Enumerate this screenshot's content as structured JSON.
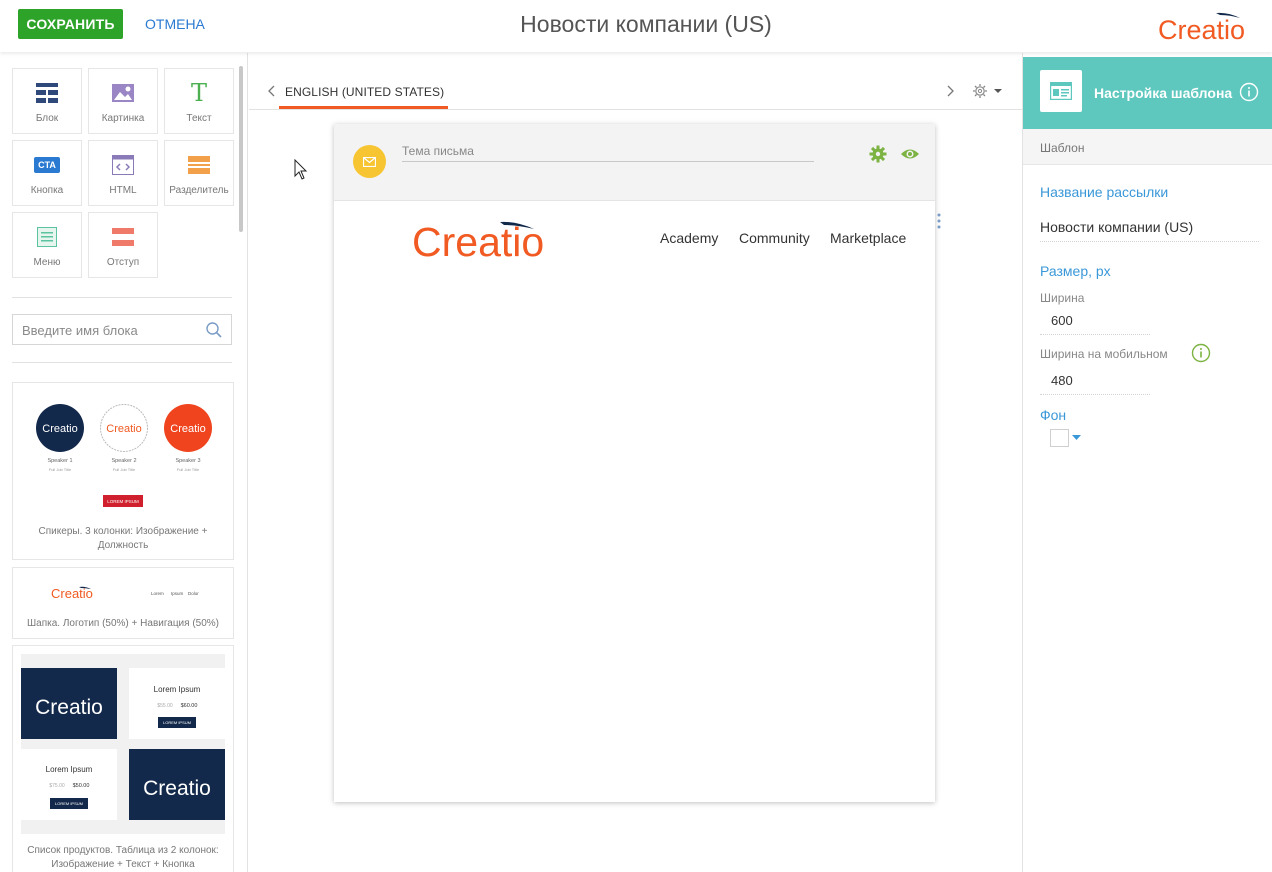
{
  "topbar": {
    "save_label": "СОХРАНИТЬ",
    "cancel_label": "ОТМЕНА",
    "title": "Новости компании (US)",
    "brand": "Creatio"
  },
  "palette": {
    "items": [
      {
        "label": "Блок",
        "icon": "block-grid-icon"
      },
      {
        "label": "Картинка",
        "icon": "image-icon"
      },
      {
        "label": "Текст",
        "icon": "text-t-icon"
      },
      {
        "label": "Кнопка",
        "icon": "cta-button-icon",
        "badge": "CTA"
      },
      {
        "label": "HTML",
        "icon": "html-code-icon"
      },
      {
        "label": "Разделитель",
        "icon": "divider-icon"
      },
      {
        "label": "Меню",
        "icon": "menu-icon"
      },
      {
        "label": "Отступ",
        "icon": "spacer-icon"
      }
    ]
  },
  "search": {
    "placeholder": "Введите имя блока"
  },
  "templates": [
    {
      "caption": "Спикеры. 3 колонки: Изображение + Должность",
      "speakers": [
        {
          "name": "Speaker 1",
          "title": "Full Job Title",
          "brand": "Creatio"
        },
        {
          "name": "Speaker 2",
          "title": "Full Job Title",
          "brand": "Creatio"
        },
        {
          "name": "Speaker 3",
          "title": "Full Job Title",
          "brand": "Creatio"
        }
      ],
      "button": "LOREM IPSUM"
    },
    {
      "caption": "Шапка. Логотип (50%) + Навигация (50%)",
      "brand": "Creatio",
      "nav": [
        "Lorem",
        "Ipsum",
        "Dolor"
      ]
    },
    {
      "caption": "Список продуктов. Таблица из 2 колонок: Изображение + Текст + Кнопка",
      "brand": "Creatio",
      "products": [
        {
          "title": "Lorem Ipsum",
          "old_price": "$55.00",
          "price": "$60.00",
          "button": "LOREM IPSUM"
        },
        {
          "title": "Lorem Ipsum",
          "old_price": "$75.00",
          "price": "$50.00",
          "button": "LOREM IPSUM"
        }
      ]
    }
  ],
  "editor": {
    "language": "ENGLISH (UNITED STATES)",
    "subject_placeholder": "Тема письма",
    "brand": "Creatio",
    "nav": [
      "Academy",
      "Community",
      "Marketplace"
    ]
  },
  "settings": {
    "title": "Настройка шаблона",
    "section": "Шаблон",
    "name_label": "Название рассылки",
    "name_value": "Новости компании (US)",
    "size_label": "Размер, px",
    "width_label": "Ширина",
    "width_value": "600",
    "mobile_width_label": "Ширина на мобильном",
    "mobile_width_value": "480",
    "background_label": "Фон"
  },
  "colors": {
    "save": "#2ea329",
    "link": "#2a7ad1",
    "brand_red": "#f15a22",
    "brand_navy": "#11294a",
    "panel_teal": "#5ec8bf",
    "accent_blue": "#3a98d8",
    "icon_green": "#7cb342"
  }
}
